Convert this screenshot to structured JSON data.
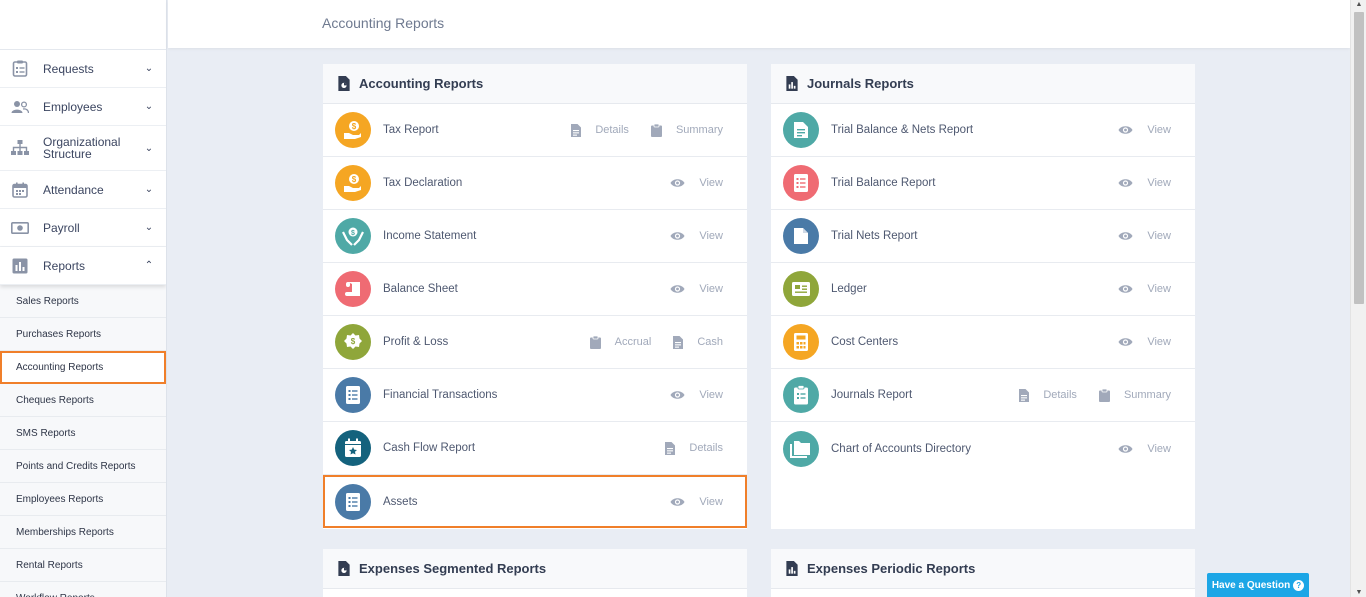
{
  "header": {
    "title": "Accounting Reports"
  },
  "sidebar": {
    "items": [
      {
        "label": "Requests",
        "icon": "clipboard-icon"
      },
      {
        "label": "Employees",
        "icon": "users-icon"
      },
      {
        "label": "Organizational Structure",
        "icon": "hierarchy-icon"
      },
      {
        "label": "Attendance",
        "icon": "calendar-icon"
      },
      {
        "label": "Payroll",
        "icon": "money-icon"
      },
      {
        "label": "Reports",
        "icon": "chart-icon"
      }
    ],
    "reports_sub": [
      "Sales Reports",
      "Purchases Reports",
      "Accounting Reports",
      "Cheques Reports",
      "SMS Reports",
      "Points and Credits Reports",
      "Employees Reports",
      "Memberships Reports",
      "Rental Reports",
      "Workflow Reports"
    ]
  },
  "accounting_panel": {
    "title": "Accounting Reports",
    "rows": [
      {
        "name": "Tax Report",
        "color": "#f5a623",
        "actions": [
          "Details",
          "Summary"
        ]
      },
      {
        "name": "Tax Declaration",
        "color": "#f5a623",
        "actions": [
          "View"
        ]
      },
      {
        "name": "Income Statement",
        "color": "#4fa9a6",
        "actions": [
          "View"
        ]
      },
      {
        "name": "Balance Sheet",
        "color": "#ef6b73",
        "actions": [
          "View"
        ]
      },
      {
        "name": "Profit & Loss",
        "color": "#8fa63a",
        "actions": [
          "Accrual",
          "Cash"
        ]
      },
      {
        "name": "Financial Transactions",
        "color": "#4a7aa7",
        "actions": [
          "View"
        ]
      },
      {
        "name": "Cash Flow Report",
        "color": "#14627d",
        "actions": [
          "Details"
        ]
      },
      {
        "name": "Assets",
        "color": "#4a7aa7",
        "actions": [
          "View"
        ]
      }
    ]
  },
  "journals_panel": {
    "title": "Journals Reports",
    "rows": [
      {
        "name": "Trial Balance & Nets Report",
        "color": "#4fa9a6",
        "actions": [
          "View"
        ]
      },
      {
        "name": "Trial Balance Report",
        "color": "#ef6b73",
        "actions": [
          "View"
        ]
      },
      {
        "name": "Trial Nets Report",
        "color": "#4a7aa7",
        "actions": [
          "View"
        ]
      },
      {
        "name": "Ledger",
        "color": "#8fa63a",
        "actions": [
          "View"
        ]
      },
      {
        "name": "Cost Centers",
        "color": "#f5a623",
        "actions": [
          "View"
        ]
      },
      {
        "name": "Journals Report",
        "color": "#4fa9a6",
        "actions": [
          "Details",
          "Summary"
        ]
      },
      {
        "name": "Chart of Accounts Directory",
        "color": "#4fa9a6",
        "actions": [
          "View"
        ]
      }
    ]
  },
  "expenses_segmented": {
    "title": "Expenses Segmented Reports"
  },
  "expenses_periodic": {
    "title": "Expenses Periodic Reports"
  },
  "help": {
    "label": "Have a Question"
  }
}
